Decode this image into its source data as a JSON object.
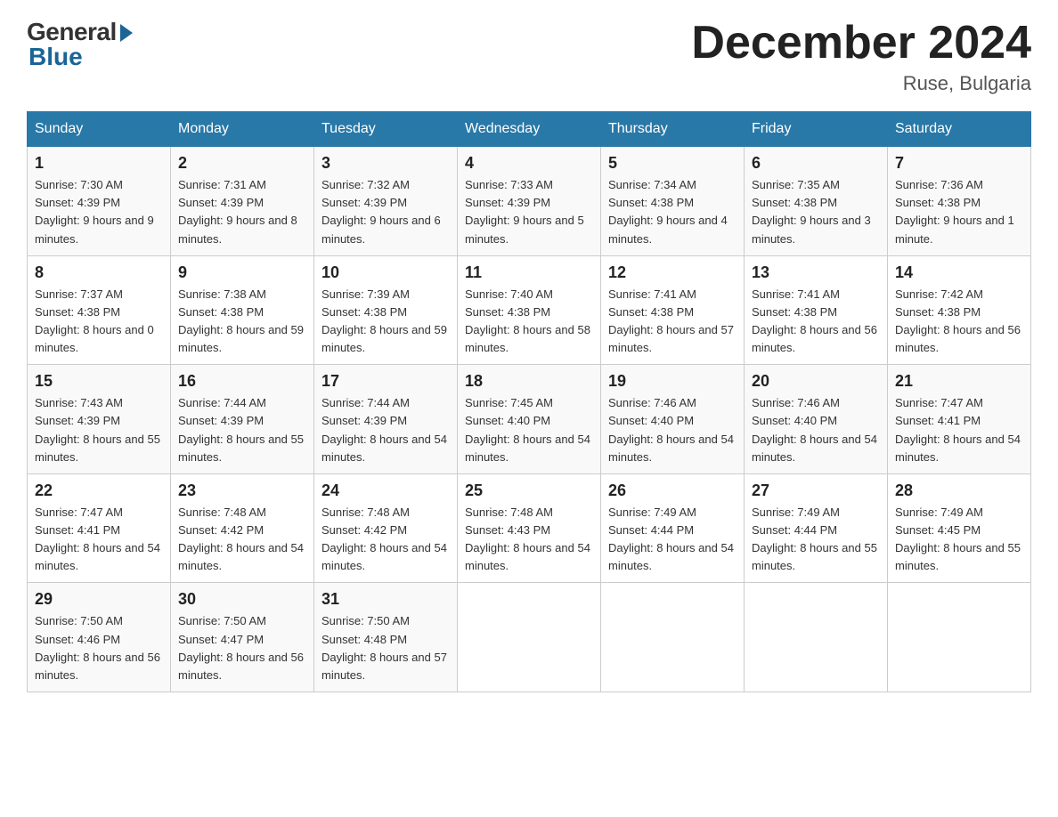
{
  "logo": {
    "general": "General",
    "blue": "Blue"
  },
  "title": "December 2024",
  "location": "Ruse, Bulgaria",
  "days_of_week": [
    "Sunday",
    "Monday",
    "Tuesday",
    "Wednesday",
    "Thursday",
    "Friday",
    "Saturday"
  ],
  "weeks": [
    [
      {
        "day": "1",
        "sunrise": "7:30 AM",
        "sunset": "4:39 PM",
        "daylight": "9 hours and 9 minutes."
      },
      {
        "day": "2",
        "sunrise": "7:31 AM",
        "sunset": "4:39 PM",
        "daylight": "9 hours and 8 minutes."
      },
      {
        "day": "3",
        "sunrise": "7:32 AM",
        "sunset": "4:39 PM",
        "daylight": "9 hours and 6 minutes."
      },
      {
        "day": "4",
        "sunrise": "7:33 AM",
        "sunset": "4:39 PM",
        "daylight": "9 hours and 5 minutes."
      },
      {
        "day": "5",
        "sunrise": "7:34 AM",
        "sunset": "4:38 PM",
        "daylight": "9 hours and 4 minutes."
      },
      {
        "day": "6",
        "sunrise": "7:35 AM",
        "sunset": "4:38 PM",
        "daylight": "9 hours and 3 minutes."
      },
      {
        "day": "7",
        "sunrise": "7:36 AM",
        "sunset": "4:38 PM",
        "daylight": "9 hours and 1 minute."
      }
    ],
    [
      {
        "day": "8",
        "sunrise": "7:37 AM",
        "sunset": "4:38 PM",
        "daylight": "8 hours and 0 minutes."
      },
      {
        "day": "9",
        "sunrise": "7:38 AM",
        "sunset": "4:38 PM",
        "daylight": "8 hours and 59 minutes."
      },
      {
        "day": "10",
        "sunrise": "7:39 AM",
        "sunset": "4:38 PM",
        "daylight": "8 hours and 59 minutes."
      },
      {
        "day": "11",
        "sunrise": "7:40 AM",
        "sunset": "4:38 PM",
        "daylight": "8 hours and 58 minutes."
      },
      {
        "day": "12",
        "sunrise": "7:41 AM",
        "sunset": "4:38 PM",
        "daylight": "8 hours and 57 minutes."
      },
      {
        "day": "13",
        "sunrise": "7:41 AM",
        "sunset": "4:38 PM",
        "daylight": "8 hours and 56 minutes."
      },
      {
        "day": "14",
        "sunrise": "7:42 AM",
        "sunset": "4:38 PM",
        "daylight": "8 hours and 56 minutes."
      }
    ],
    [
      {
        "day": "15",
        "sunrise": "7:43 AM",
        "sunset": "4:39 PM",
        "daylight": "8 hours and 55 minutes."
      },
      {
        "day": "16",
        "sunrise": "7:44 AM",
        "sunset": "4:39 PM",
        "daylight": "8 hours and 55 minutes."
      },
      {
        "day": "17",
        "sunrise": "7:44 AM",
        "sunset": "4:39 PM",
        "daylight": "8 hours and 54 minutes."
      },
      {
        "day": "18",
        "sunrise": "7:45 AM",
        "sunset": "4:40 PM",
        "daylight": "8 hours and 54 minutes."
      },
      {
        "day": "19",
        "sunrise": "7:46 AM",
        "sunset": "4:40 PM",
        "daylight": "8 hours and 54 minutes."
      },
      {
        "day": "20",
        "sunrise": "7:46 AM",
        "sunset": "4:40 PM",
        "daylight": "8 hours and 54 minutes."
      },
      {
        "day": "21",
        "sunrise": "7:47 AM",
        "sunset": "4:41 PM",
        "daylight": "8 hours and 54 minutes."
      }
    ],
    [
      {
        "day": "22",
        "sunrise": "7:47 AM",
        "sunset": "4:41 PM",
        "daylight": "8 hours and 54 minutes."
      },
      {
        "day": "23",
        "sunrise": "7:48 AM",
        "sunset": "4:42 PM",
        "daylight": "8 hours and 54 minutes."
      },
      {
        "day": "24",
        "sunrise": "7:48 AM",
        "sunset": "4:42 PM",
        "daylight": "8 hours and 54 minutes."
      },
      {
        "day": "25",
        "sunrise": "7:48 AM",
        "sunset": "4:43 PM",
        "daylight": "8 hours and 54 minutes."
      },
      {
        "day": "26",
        "sunrise": "7:49 AM",
        "sunset": "4:44 PM",
        "daylight": "8 hours and 54 minutes."
      },
      {
        "day": "27",
        "sunrise": "7:49 AM",
        "sunset": "4:44 PM",
        "daylight": "8 hours and 55 minutes."
      },
      {
        "day": "28",
        "sunrise": "7:49 AM",
        "sunset": "4:45 PM",
        "daylight": "8 hours and 55 minutes."
      }
    ],
    [
      {
        "day": "29",
        "sunrise": "7:50 AM",
        "sunset": "4:46 PM",
        "daylight": "8 hours and 56 minutes."
      },
      {
        "day": "30",
        "sunrise": "7:50 AM",
        "sunset": "4:47 PM",
        "daylight": "8 hours and 56 minutes."
      },
      {
        "day": "31",
        "sunrise": "7:50 AM",
        "sunset": "4:48 PM",
        "daylight": "8 hours and 57 minutes."
      },
      null,
      null,
      null,
      null
    ]
  ],
  "labels": {
    "sunrise": "Sunrise:",
    "sunset": "Sunset:",
    "daylight": "Daylight:"
  }
}
